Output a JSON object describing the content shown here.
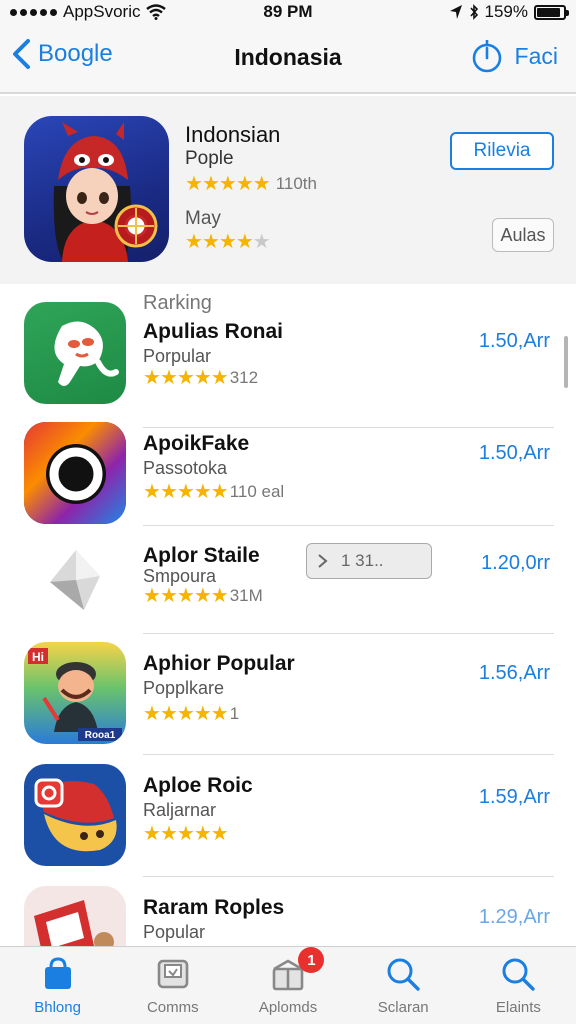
{
  "status_bar": {
    "carrier": "AppSvoric",
    "time": "89 PM",
    "battery": "159%",
    "battery_level": 0.9
  },
  "nav": {
    "back_label": "Boogle",
    "title": "Indonasia",
    "right_label": "Faci"
  },
  "featured": {
    "title": "Indonsian",
    "subtitle": "Pople",
    "rating_count": "110th",
    "rating1": 5,
    "month_label": "May",
    "rating2": 4,
    "primary_button": "Rilevia",
    "secondary_button": "Aulas"
  },
  "ranking": {
    "section_label": "Rarking",
    "items": [
      {
        "name": "Apulias Ronai",
        "category": "Porpular",
        "rating": 4.5,
        "count": "312",
        "price": "1.50,Arr"
      },
      {
        "name": "ApoikFake",
        "category": "Passotoka",
        "rating": 5,
        "count": "110 eal",
        "price": "1.50,Arr"
      },
      {
        "name": "Aplor Staile",
        "category": "Smpoura",
        "rating": 4.5,
        "count": "31M",
        "price": "1.20,0rr",
        "progress_label": "1 31.."
      },
      {
        "name": "Aphior Popular",
        "category": "Popplkare",
        "rating": 4.5,
        "count": "1",
        "price": "1.56,Arr"
      },
      {
        "name": "Aploe Roic",
        "category": "Raljarnar",
        "rating": 5,
        "count": "",
        "price": "1.59,Arr"
      },
      {
        "name": "Raram Roples",
        "category": "Popular",
        "rating": 0,
        "count": "",
        "price": "1.29,Arr"
      }
    ],
    "icon_labels": {
      "item4": "Hi",
      "item4_bottom": "Rooa1"
    }
  },
  "tabbar": {
    "tabs": [
      {
        "label": "Bhlong",
        "icon": "bag-icon",
        "active": true
      },
      {
        "label": "Comms",
        "icon": "tray-icon",
        "active": false
      },
      {
        "label": "Aplomds",
        "icon": "gift-box-icon",
        "active": false,
        "badge": "1"
      },
      {
        "label": "Sclaran",
        "icon": "search-icon",
        "active": false
      },
      {
        "label": "Elaints",
        "icon": "search-icon",
        "active": false
      }
    ]
  },
  "colors": {
    "accent": "#1a7fe0",
    "star": "#f4b400",
    "badge": "#e8302f"
  }
}
